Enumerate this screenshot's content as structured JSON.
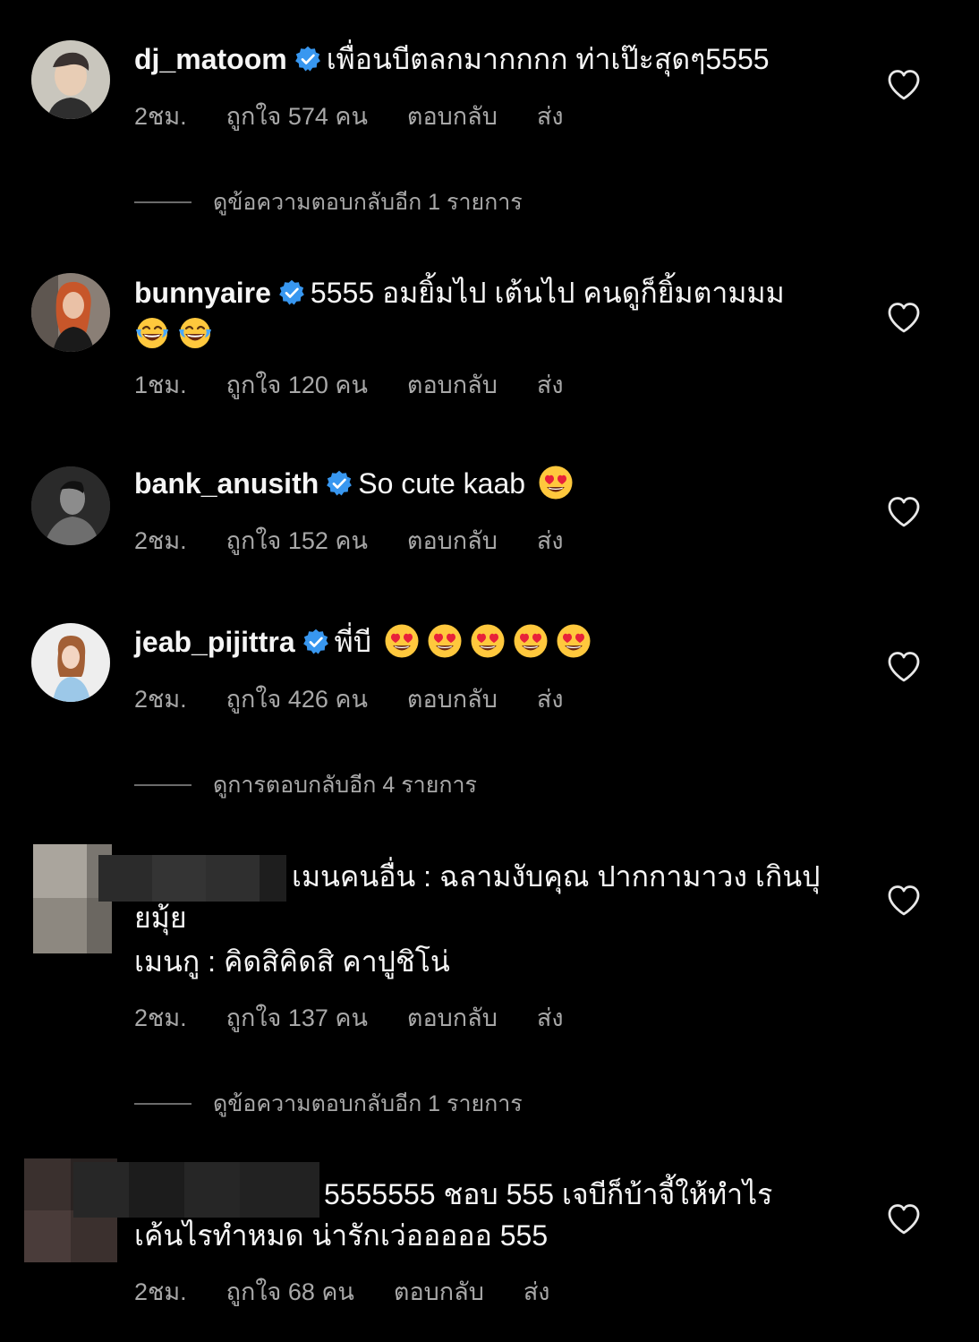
{
  "comments": [
    {
      "username": "dj_matoom",
      "text": "เพื่อนบีตลกมากกกก ท่าเป๊ะสุดๆ5555",
      "time": "2ชม.",
      "likes": "ถูกใจ 574 คน",
      "reply": "ตอบกลับ",
      "send": "ส่ง",
      "view_replies": "ดูข้อความตอบกลับอีก 1 รายการ"
    },
    {
      "username": "bunnyaire",
      "text": "5555 อมยิ้มไป เต้นไป คนดูก็ยิ้มตามมม",
      "time": "1ชม.",
      "likes": "ถูกใจ 120 คน",
      "reply": "ตอบกลับ",
      "send": "ส่ง"
    },
    {
      "username": "bank_anusith",
      "text": "So cute kaab",
      "time": "2ชม.",
      "likes": "ถูกใจ 152 คน",
      "reply": "ตอบกลับ",
      "send": "ส่ง"
    },
    {
      "username": "jeab_pijittra",
      "text": "พี่บี",
      "time": "2ชม.",
      "likes": "ถูกใจ 426 คน",
      "reply": "ตอบกลับ",
      "send": "ส่ง",
      "view_replies": "ดูการตอบกลับอีก 4 รายการ"
    },
    {
      "text_line1": "เมนคนอื่น : ฉลามงับคุณ ปากกามาวง เกินปุ",
      "text_line2": "ยมุ้ย",
      "text_line3": "เมนกู : คิดสิคิดสิ คาปูชิโน่",
      "time": "2ชม.",
      "likes": "ถูกใจ 137 คน",
      "reply": "ตอบกลับ",
      "send": "ส่ง",
      "view_replies": "ดูข้อความตอบกลับอีก 1 รายการ"
    },
    {
      "text_line1": "5555555 ชอบ 555 เจบีก็บ้าจี้ให้ทำไร",
      "text_line2": "เค้นไรทำหมด น่ารักเว่อออออ 555",
      "time": "2ชม.",
      "likes": "ถูกใจ 68 คน",
      "reply": "ตอบกลับ",
      "send": "ส่ง"
    }
  ],
  "icons": {
    "heart": "heart-icon",
    "verified": "verified-badge-icon",
    "emoji_laugh": "tears-of-joy-emoji",
    "emoji_heart_eyes": "heart-eyes-emoji"
  },
  "colors": {
    "background": "#000000",
    "text": "#f5f5f5",
    "muted": "#a8a8a8",
    "verified": "#3897f0"
  }
}
